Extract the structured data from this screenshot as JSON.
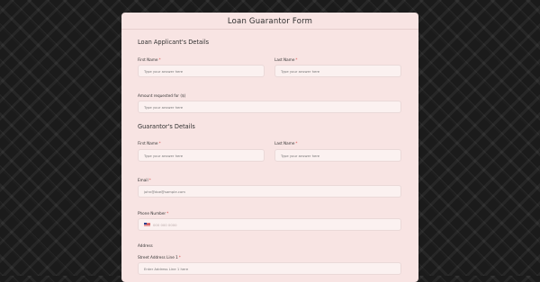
{
  "form": {
    "title": "Loan Guarantor Form"
  },
  "applicant": {
    "section_title": "Loan Applicant's Details",
    "first_name": {
      "label": "First Name",
      "required": "*",
      "placeholder": "Type your answer here"
    },
    "last_name": {
      "label": "Last Name",
      "required": "*",
      "placeholder": "Type your answer here"
    },
    "amount": {
      "label": "Amount requested for ($)",
      "placeholder": "Type your answer here"
    }
  },
  "guarantor": {
    "section_title": "Guarantor's Details",
    "first_name": {
      "label": "First Name",
      "required": "*",
      "placeholder": "Type your answer here"
    },
    "last_name": {
      "label": "Last Name",
      "required": "*",
      "placeholder": "Type your answer here"
    },
    "email": {
      "label": "Email",
      "required": "*",
      "placeholder": "john@doe@sample.com"
    },
    "phone": {
      "label": "Phone Number",
      "required": "*",
      "placeholder": "000 000 0000",
      "flag_icon": "us-flag-icon"
    },
    "address": {
      "label": "Address",
      "line1": {
        "label": "Street Address Line 1",
        "required": "*",
        "placeholder": "Enter Address Line 1 here"
      }
    }
  }
}
